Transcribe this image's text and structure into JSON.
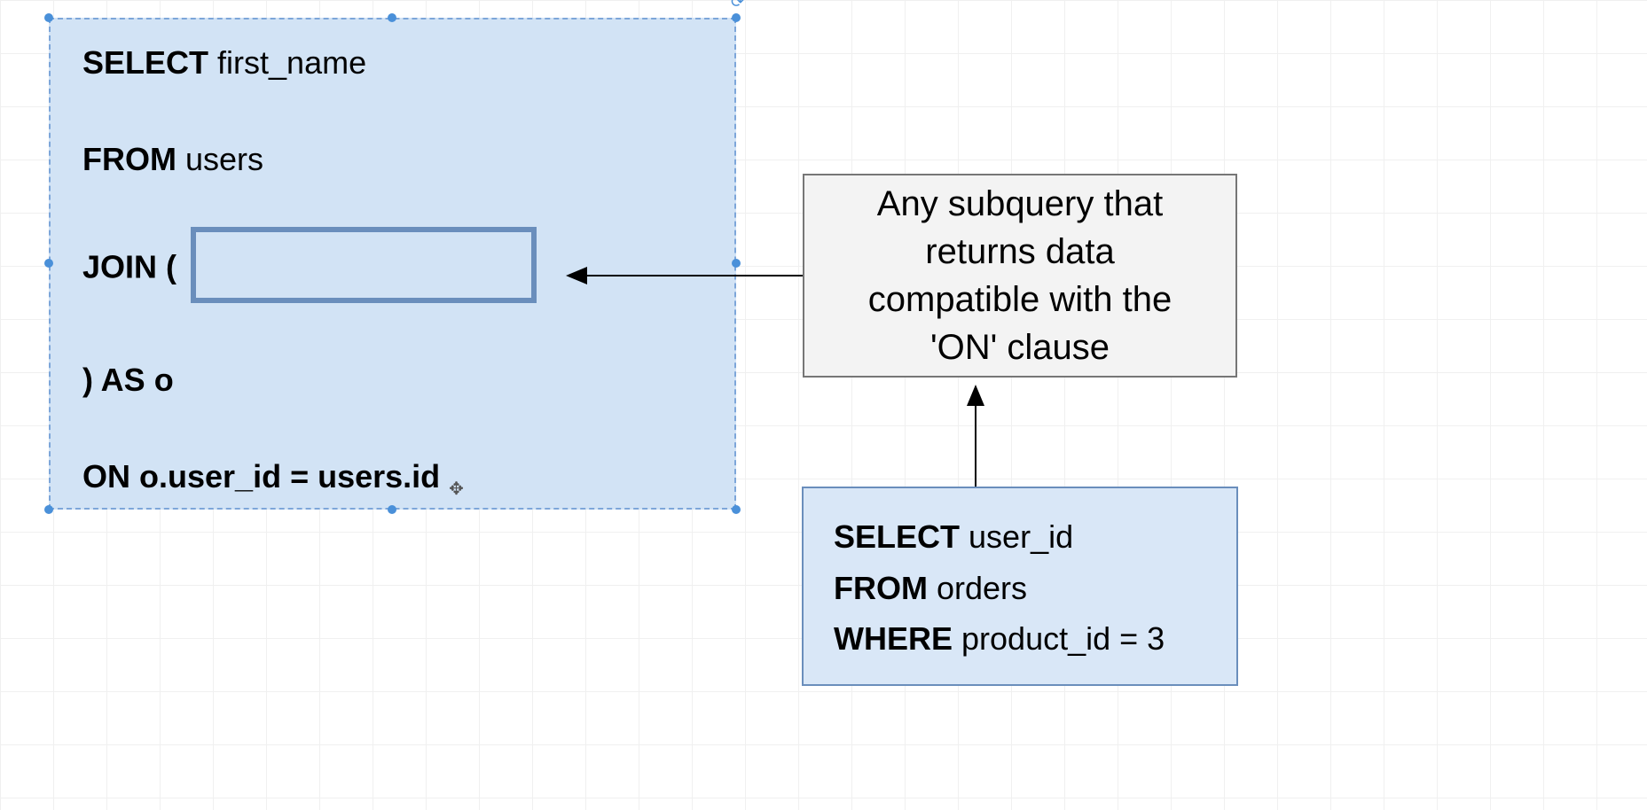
{
  "main_query": {
    "select": {
      "keyword": "SELECT",
      "value": "first_name"
    },
    "from": {
      "keyword": "FROM",
      "value": "users"
    },
    "join": {
      "keyword": "JOIN (",
      "value": ""
    },
    "as": {
      "keyword": ") AS",
      "value": "o"
    },
    "on": {
      "keyword": "ON",
      "value": "o.user_id = users.id"
    }
  },
  "annotation": "Any subquery that returns data compatible with the 'ON' clause",
  "subquery": {
    "select": {
      "keyword": "SELECT",
      "value": "user_id"
    },
    "from": {
      "keyword": "FROM",
      "value": "orders"
    },
    "where": {
      "keyword": "WHERE",
      "value": "product_id = 3"
    }
  },
  "icons": {
    "rotate": "⟳",
    "move": "✥"
  }
}
